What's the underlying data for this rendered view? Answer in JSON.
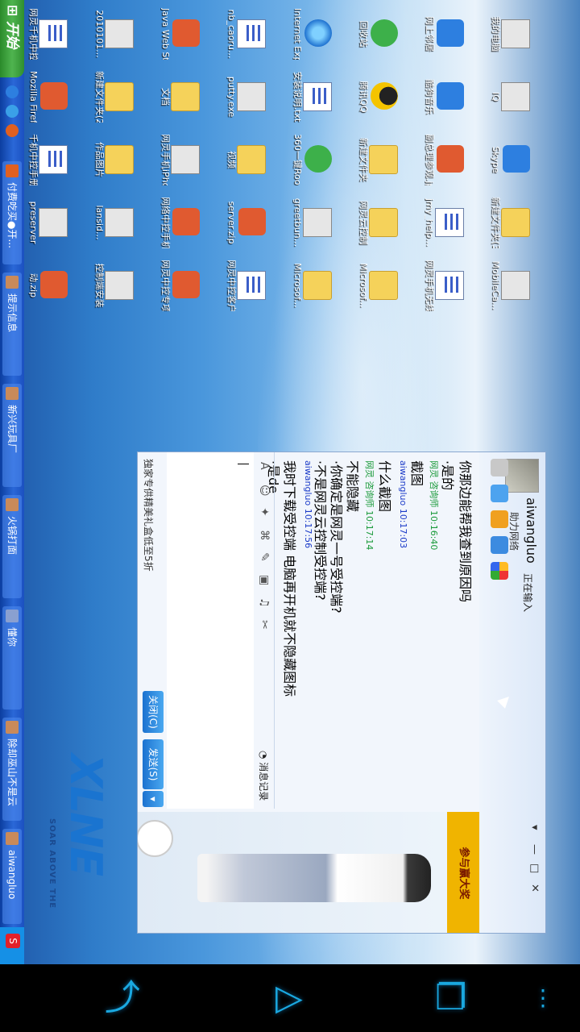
{
  "taskbar": {
    "start_label": "开始",
    "buttons": [
      {
        "label": "付费吃买●开..."
      },
      {
        "label": "提示信息"
      },
      {
        "label": "新兴玩具厂"
      },
      {
        "label": "火锅打面"
      },
      {
        "label": "懂你"
      },
      {
        "label": "除却巫山不是云"
      },
      {
        "label": "aiwangluo"
      }
    ],
    "tray_icon": "sogou-icon"
  },
  "desktop": {
    "icons": [
      {
        "label": "我的电脑",
        "kind": "computer"
      },
      {
        "label": "网上邻居",
        "kind": "network"
      },
      {
        "label": "回收站",
        "kind": "recycle"
      },
      {
        "label": "Internet Explorer",
        "kind": "ie"
      },
      {
        "label": "nb_caoru...",
        "kind": "doc"
      },
      {
        "label": "Java Web Start",
        "kind": "java"
      },
      {
        "label": "2010101...",
        "kind": "app"
      },
      {
        "label": "网灵千机中控客户端",
        "kind": "doc"
      },
      {
        "label": "IQ",
        "kind": "app"
      },
      {
        "label": "酷狗音乐",
        "kind": "kugou"
      },
      {
        "label": "腾讯QQ",
        "kind": "qq"
      },
      {
        "label": "安装说明.txt",
        "kind": "doc"
      },
      {
        "label": "putty.exe",
        "kind": "app"
      },
      {
        "label": "文档",
        "kind": "folder"
      },
      {
        "label": "新建文件夹(2)",
        "kind": "folder"
      },
      {
        "label": "Mozilla Firefox",
        "kind": "firefox"
      },
      {
        "label": "Skype",
        "kind": "skype"
      },
      {
        "label": "副总理参观.jpg",
        "kind": "img"
      },
      {
        "label": "新建文件夹",
        "kind": "folder"
      },
      {
        "label": "360一键Root",
        "kind": "root"
      },
      {
        "label": "视频",
        "kind": "folder"
      },
      {
        "label": "网灵手机iPhone助手",
        "kind": "app"
      },
      {
        "label": "作品图片",
        "kind": "folder"
      },
      {
        "label": "千机中控手册",
        "kind": "doc"
      },
      {
        "label": "新建文件夹(3)",
        "kind": "folder"
      },
      {
        "label": "jmy_help...",
        "kind": "doc"
      },
      {
        "label": "网灵云控制",
        "kind": "folder"
      },
      {
        "label": "greetbun...",
        "kind": "app"
      },
      {
        "label": "server.zip",
        "kind": "zip"
      },
      {
        "label": "网络中控手机客户端",
        "kind": "ppt"
      },
      {
        "label": "lansid...",
        "kind": "app"
      },
      {
        "label": "preserver",
        "kind": "app"
      },
      {
        "label": "MobileCa...",
        "kind": "app"
      },
      {
        "label": "网灵手机无线控制",
        "kind": "doc"
      },
      {
        "label": "Microsof...",
        "kind": "folder"
      },
      {
        "label": "Microsof...",
        "kind": "folder"
      },
      {
        "label": "网灵中控客户端",
        "kind": "doc"
      },
      {
        "label": "网灵中控专项",
        "kind": "ppt"
      },
      {
        "label": "控制端安装",
        "kind": "app"
      },
      {
        "label": "动.zip",
        "kind": "zip"
      }
    ]
  },
  "chat": {
    "contact_name": "aiwangluo",
    "contact_status": "正在输入",
    "contact_signature": "助力网络",
    "messages": [
      {
        "text": "你那边能帮我查到原因吗",
        "kind": "text"
      },
      {
        "text": "·是的",
        "kind": "text"
      },
      {
        "text": "网灵 咨询师  10:16:40",
        "kind": "sys"
      },
      {
        "text": "截图",
        "kind": "text"
      },
      {
        "text": "aiwangluo  10:17:03",
        "kind": "me"
      },
      {
        "text": "什么截图",
        "kind": "text"
      },
      {
        "text": "网灵 咨询师  10:17:14",
        "kind": "sys"
      },
      {
        "text": "不能隐藏",
        "kind": "text"
      },
      {
        "text": "·你确定是网灵一号受控端?",
        "kind": "text"
      },
      {
        "text": "·不是网灵云控制受控端?",
        "kind": "text"
      },
      {
        "text": "aiwangluo  10:17:56",
        "kind": "me"
      },
      {
        "text": "我时下载受控端   电脑再开机就不隐藏图标",
        "kind": "text"
      },
      {
        "text": "·是de",
        "kind": "text"
      }
    ],
    "history_label": "消息记录",
    "input_value": "",
    "promo_text": "独家专供精美礼盒低至5折",
    "close_label": "关闭(C)",
    "send_label": "发送(S)",
    "ad_label": "参与赢大奖"
  },
  "logo": {
    "text": "XLNE",
    "subtitle": "SOAR ABOVE THE"
  },
  "navbar": {
    "back_icon": "back-icon",
    "home_icon": "home-icon",
    "recent_icon": "recent-apps-icon",
    "menu_icon": "menu-icon"
  }
}
